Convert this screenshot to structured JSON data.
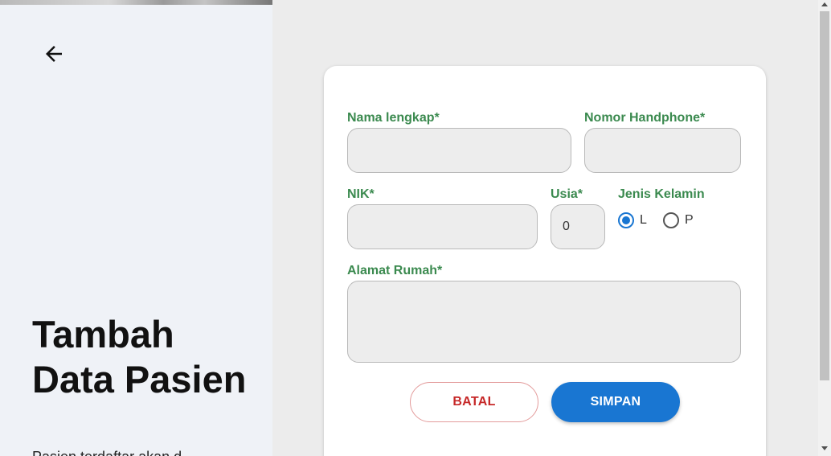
{
  "sidebar": {
    "title": "Tambah Data Pasien",
    "subtitle": "Pasien terdaftar akan d"
  },
  "form": {
    "nama": {
      "label": "Nama lengkap*",
      "value": ""
    },
    "phone": {
      "label": "Nomor Handphone*",
      "value": ""
    },
    "nik": {
      "label": "NIK*",
      "value": ""
    },
    "usia": {
      "label": "Usia*",
      "value": "0"
    },
    "gender": {
      "label": "Jenis Kelamin",
      "options": [
        "L",
        "P"
      ],
      "selected": "L"
    },
    "alamat": {
      "label": "Alamat Rumah*",
      "value": ""
    },
    "cancel_label": "BATAL",
    "save_label": "SIMPAN"
  },
  "colors": {
    "label_green": "#3b8a4f",
    "primary_blue": "#1976d2",
    "cancel_red": "#c62828"
  }
}
